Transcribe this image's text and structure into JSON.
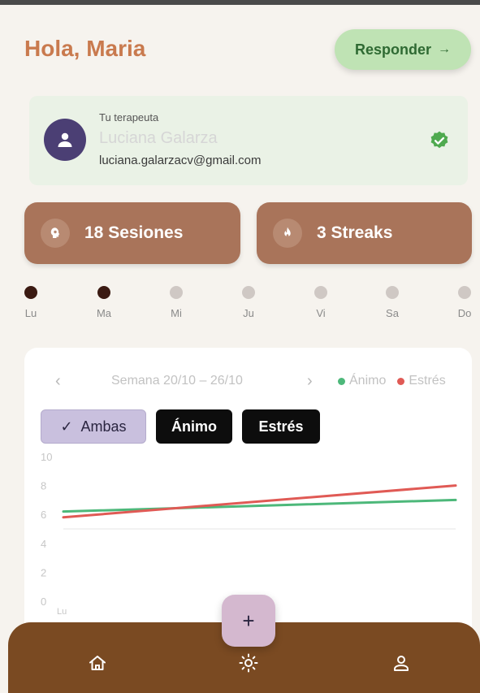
{
  "header": {
    "greeting": "Hola, Maria",
    "respond_label": "Responder",
    "respond_arrow": "→"
  },
  "therapist": {
    "role_label": "Tu terapeuta",
    "name": "Luciana Galarza",
    "email": "luciana.galarzacv@gmail.com",
    "verified_icon": "verified-badge-icon"
  },
  "stats": {
    "sessions_label": "18 Sesiones",
    "sessions_icon": "brain-head-icon",
    "streaks_label": "3 Streaks",
    "streaks_icon": "flame-icon"
  },
  "week_days": [
    {
      "label": "Lu",
      "done": true
    },
    {
      "label": "Ma",
      "done": true
    },
    {
      "label": "Mi",
      "done": false
    },
    {
      "label": "Ju",
      "done": false
    },
    {
      "label": "Vi",
      "done": false
    },
    {
      "label": "Sa",
      "done": false
    },
    {
      "label": "Do",
      "done": false
    }
  ],
  "chart_card": {
    "prev_icon": "‹",
    "next_icon": "›",
    "week_range": "Semana 20/10 – 26/10",
    "legend": [
      {
        "name": "Ánimo",
        "color": "#4db87a"
      },
      {
        "name": "Estrés",
        "color": "#e05a55"
      }
    ],
    "filters": {
      "both_label": "Ambas",
      "both_check": "✓",
      "mood_label": "Ánimo",
      "stress_label": "Estrés"
    }
  },
  "chart_data": {
    "type": "line",
    "x": [
      "Lu"
    ],
    "ylim": [
      0,
      10
    ],
    "yticks": [
      "10",
      "8",
      "6",
      "4",
      "2",
      "0"
    ],
    "series": [
      {
        "name": "Ánimo",
        "color": "#4db87a",
        "start": 6.2,
        "end": 7.0
      },
      {
        "name": "Estrés",
        "color": "#e05a55",
        "start": 5.8,
        "end": 8.0
      }
    ],
    "reference_line": 5.0
  },
  "fab": {
    "label": "+"
  },
  "bottom_nav": {
    "items": [
      "home-icon",
      "sun-icon",
      "profile-icon"
    ]
  },
  "colors": {
    "accent": "#c97a4e",
    "card_brown": "#a9745a",
    "nav_brown": "#7a4a22"
  }
}
